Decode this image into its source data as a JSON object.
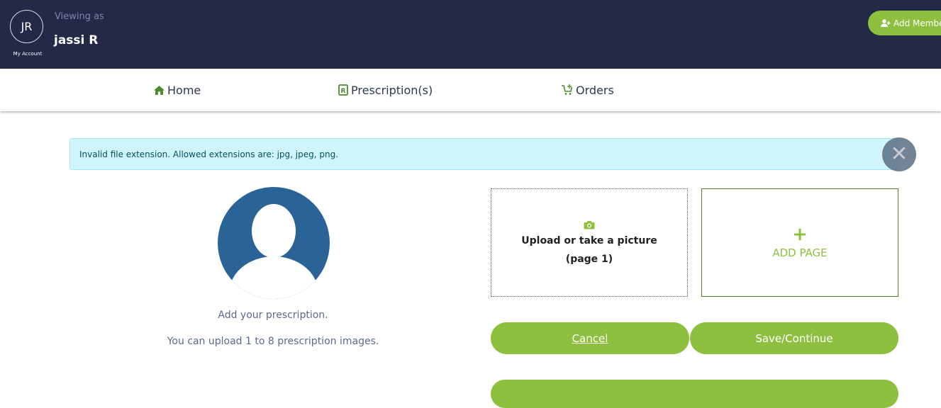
{
  "header": {
    "initials": "JR",
    "my_account": "My Account",
    "viewing_as": "Viewing as",
    "user_name": "jassi R",
    "add_member": "Add Membe"
  },
  "nav": {
    "items": [
      {
        "label": "Home",
        "icon": "home-icon"
      },
      {
        "label": "Prescription(s)",
        "icon": "prescription-icon"
      },
      {
        "label": "Orders",
        "icon": "cart-icon"
      }
    ]
  },
  "alert": {
    "message": "Invalid file extension. Allowed extensions are: jpg, jpeg, png.",
    "close_icon": "close-icon"
  },
  "left": {
    "helper_line1": "Add your prescription.",
    "helper_line2": "You can upload 1 to 8 prescription images."
  },
  "upload": {
    "title": "Upload or take a picture",
    "page": "(page 1)",
    "icon": "camera-icon"
  },
  "add_page": {
    "plus": "+",
    "label": "ADD PAGE"
  },
  "buttons": {
    "cancel": "Cancel",
    "save": "Save/Continue"
  },
  "colors": {
    "header_bg": "#232946",
    "accent": "#8dc03f",
    "alert_bg": "#cff4fc",
    "avatar_blue": "#2a6496"
  }
}
